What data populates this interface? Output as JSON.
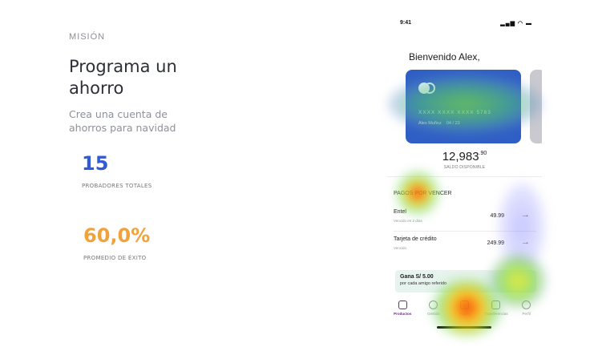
{
  "mission": {
    "label": "MISIÓN",
    "title_line1": "Programa un",
    "title_line2": "ahorro",
    "desc_line1": "Crea una cuenta de",
    "desc_line2": "ahorros para navidad"
  },
  "stats": [
    {
      "value": "15",
      "label": "PROBADORES TOTALES"
    },
    {
      "value": "60,0%",
      "label": "PROMEDIO DE ÉXITO"
    }
  ],
  "phone": {
    "time": "9:41",
    "status_icons": "▂▄▆ ◠ ▬",
    "greeting": "Bienvenido Alex,",
    "card": {
      "number": "XXXX  XXXX  XXXX  5783",
      "holder": "Alex Muñoz",
      "expiry": "04 / 23"
    },
    "balance": {
      "value": "12,983",
      "cents": ".90",
      "label": "SALDO DISPONIBLE"
    },
    "section_title": "PAGOS POR VENCER",
    "bills": [
      {
        "name": "Entel",
        "sub": "Vencido en 2 días",
        "amount": "49.99"
      },
      {
        "name": "Tarjeta de crédito",
        "sub": "Vencido",
        "amount": "249.99"
      }
    ],
    "promo": {
      "title": "Gana S/ 5.00",
      "subtitle": "por cada amigo referido"
    },
    "tabs": [
      {
        "label": "Productos",
        "icon": "products-icon",
        "active": true
      },
      {
        "label": "Gestión",
        "icon": "clock-icon",
        "active": false
      },
      {
        "label": "Pagos",
        "icon": "payments-icon",
        "active": false
      },
      {
        "label": "Transferencias",
        "icon": "transfer-icon",
        "active": false
      },
      {
        "label": "Perfil",
        "icon": "profile-icon",
        "active": false
      }
    ]
  },
  "colors": {
    "stat_blue": "#2f5bd9",
    "stat_orange": "#f2a23a",
    "card_blue": "#2f5fc4",
    "arrow_green": "#2e8b57",
    "tab_active": "#6a2a8e"
  }
}
